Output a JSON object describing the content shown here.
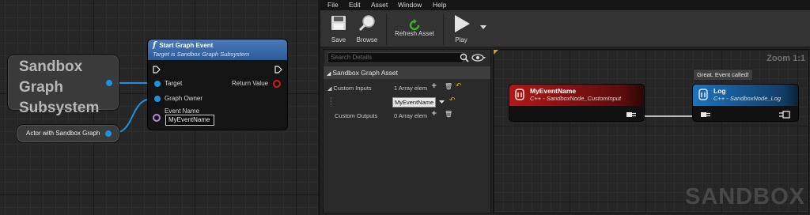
{
  "blueprint": {
    "subsystem_node": {
      "label_lines": [
        "Sandbox",
        "Graph",
        "Subsystem"
      ]
    },
    "function_node": {
      "title": "Start Graph Event",
      "subtitle": "Target is Sandbox Graph Subsystem",
      "pins": {
        "target": "Target",
        "graph_owner": "Graph Owner",
        "event_name": "Event Name",
        "event_name_value": "MyEventName",
        "return_value": "Return Value"
      }
    },
    "actor_node": {
      "label": "Actor with Sandbox Graph"
    }
  },
  "editor": {
    "menu": [
      "File",
      "Edit",
      "Asset",
      "Window",
      "Help"
    ],
    "toolbar": {
      "save": "Save",
      "browse": "Browse",
      "refresh": "Refresh Asset",
      "play": "Play"
    },
    "details": {
      "search_placeholder": "Search Details",
      "section_title": "Sandbox Graph Asset",
      "custom_inputs_label": "Custom Inputs",
      "custom_inputs_value": "1 Array elem",
      "input_field_value": "MyEventName",
      "custom_outputs_label": "Custom Outputs",
      "custom_outputs_value": "0 Array elem"
    },
    "graph": {
      "zoom": "Zoom 1:1",
      "watermark": "SANDBOX",
      "tooltip": "Great. Event called!",
      "nodes": [
        {
          "title": "MyEventName",
          "subtitle": "C++ - SandboxNode_CustomInput",
          "header_color": "#9c1515"
        },
        {
          "title": "Log",
          "subtitle": "C++ - SandboxNode_Log",
          "header_color": "#1a5e9a"
        }
      ]
    }
  },
  "colors": {
    "object_pin": "#1e90e0",
    "name_pin": "#b48ad8",
    "return_pin": "#d21c1c"
  }
}
